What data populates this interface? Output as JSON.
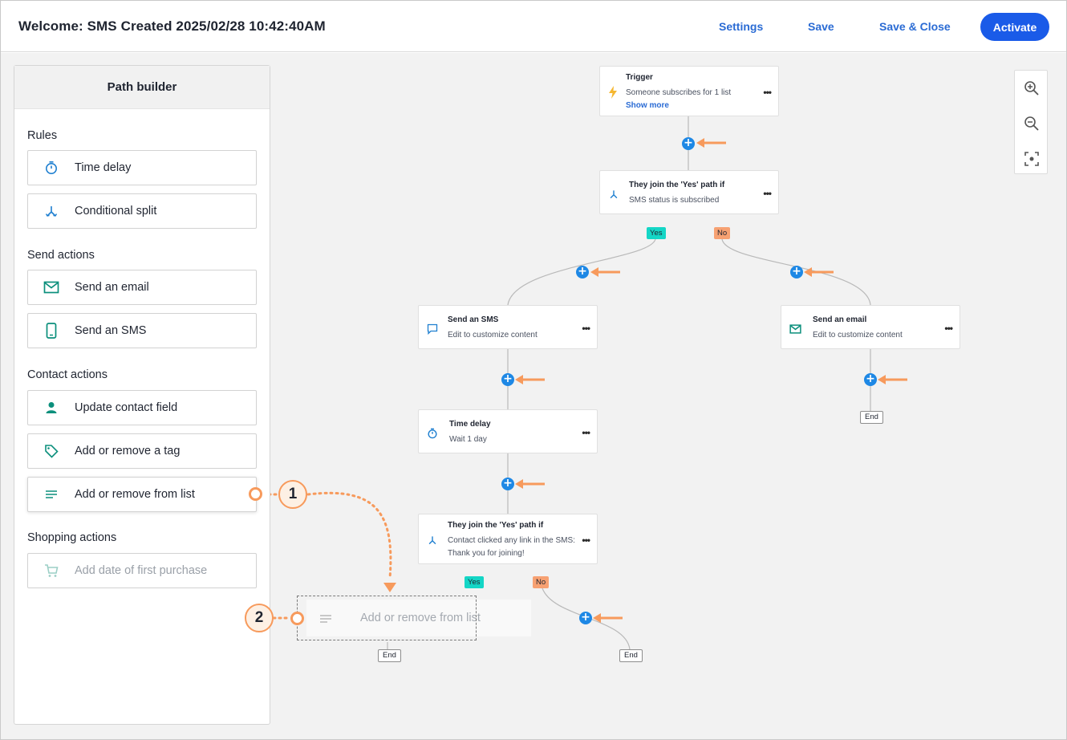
{
  "header": {
    "title": "Welcome: SMS Created 2025/02/28 10:42:40AM",
    "settings_label": "Settings",
    "save_label": "Save",
    "save_close_label": "Save & Close",
    "activate_label": "Activate"
  },
  "sidebar": {
    "title": "Path builder",
    "sections": [
      {
        "title": "Rules",
        "items": [
          {
            "label": "Time delay",
            "icon": "timer-icon"
          },
          {
            "label": "Conditional split",
            "icon": "split-icon"
          }
        ]
      },
      {
        "title": "Send actions",
        "items": [
          {
            "label": "Send an email",
            "icon": "envelope-icon"
          },
          {
            "label": "Send an SMS",
            "icon": "phone-icon"
          }
        ]
      },
      {
        "title": "Contact actions",
        "items": [
          {
            "label": "Update contact field",
            "icon": "person-icon"
          },
          {
            "label": "Add or remove a tag",
            "icon": "tag-icon"
          },
          {
            "label": "Add or remove from list",
            "icon": "list-icon"
          }
        ]
      },
      {
        "title": "Shopping actions",
        "items": [
          {
            "label": "Add date of first purchase",
            "icon": "cart-icon",
            "disabled": true
          }
        ]
      }
    ]
  },
  "flow": {
    "trigger": {
      "title": "Trigger",
      "subtitle": "Someone subscribes for 1 list",
      "link": "Show more"
    },
    "split1": {
      "title": "They join the 'Yes' path if",
      "subtitle": "SMS status is subscribed"
    },
    "sms": {
      "title": "Send an SMS",
      "subtitle": "Edit to customize content"
    },
    "email": {
      "title": "Send an email",
      "subtitle": "Edit to customize content"
    },
    "delay": {
      "title": "Time delay",
      "subtitle": "Wait 1 day"
    },
    "split2": {
      "title": "They join the 'Yes' path if",
      "subtitle": "Contact clicked any link in the SMS:",
      "subtitle2": "Thank you for joining!"
    },
    "yes_label": "Yes",
    "no_label": "No",
    "end_label": "End",
    "more_label": "•••",
    "plus_label": "+"
  },
  "drag": {
    "ghost_label": "Add or remove from list"
  },
  "callouts": {
    "one": "1",
    "two": "2"
  },
  "colors": {
    "accent": "#1a5be8",
    "plus": "#1e88e5",
    "yes": "#14d6c6",
    "no": "#f7a172",
    "annotation": "#f79a5c"
  }
}
